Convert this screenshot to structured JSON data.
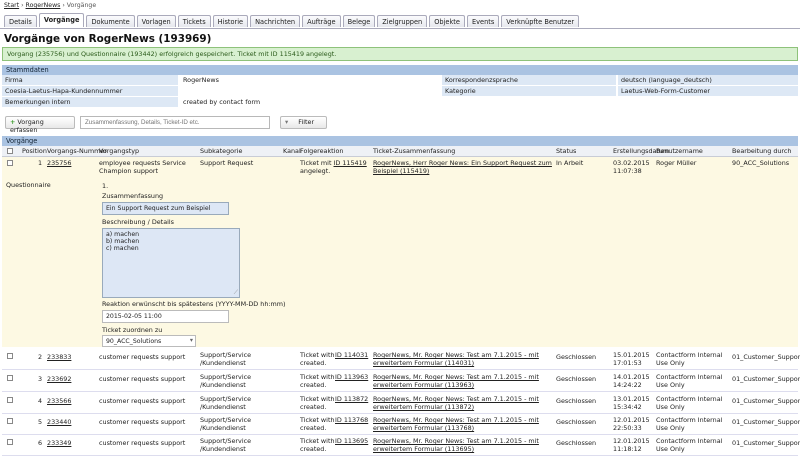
{
  "breadcrumb": {
    "a": "Start",
    "b": "RogerNews",
    "c": "Vorgänge"
  },
  "tabs": [
    "Details",
    "Vorgänge",
    "Dokumente",
    "Vorlagen",
    "Tickets",
    "Historie",
    "Nachrichten",
    "Aufträge",
    "Belege",
    "Zielgruppen",
    "Objekte",
    "Events",
    "Verknüpfte Benutzer"
  ],
  "page_title": "Vorgänge von RogerNews (193969)",
  "success_message": "Vorgang (235756) und Questionnaire (193442) erfolgreich gespeichert. Ticket mit ID 115419 angelegt.",
  "stammdaten": {
    "title": "Stammdaten",
    "firma_label": "Firma",
    "firma_value": "RogerNews",
    "korrespondenz_label": "Korrespondenzsprache",
    "korrespondenz_value": "deutsch (language_deutsch)",
    "kundennummer_label": "Coesia-Laetus-Hapa-Kundennummer",
    "kategorie_label": "Kategorie",
    "kategorie_value": "Laetus-Web-Form-Customer",
    "bemerkungen_label": "Bemerkungen intern",
    "bemerkungen_value": "created by contact form"
  },
  "toolbar": {
    "create_button": "Vorgang erfassen",
    "search_placeholder": "Zusammenfassung, Details, Ticket-ID etc.",
    "filter_button": "Filter"
  },
  "vorgaenge_title": "Vorgänge",
  "columns": {
    "position": "Position",
    "nummer": "Vorgangs-Nummer",
    "typ": "Vorgangstyp",
    "subkategorie": "Subkategorie",
    "kanal": "Kanal",
    "folge": "Folgereaktion",
    "ticket": "Ticket-Zusammenfassung",
    "status": "Status",
    "datum": "Erstellungsdatum",
    "benutzer": "Benutzername",
    "bearbeitung": "Bearbeitung durch"
  },
  "row1": {
    "pos": "1",
    "nummer": "235756",
    "typ1": "employee requests Service",
    "typ2": "Champion support",
    "sub": "Support Request",
    "folge_a": "Ticket mit",
    "folge_id": "ID 115419",
    "folge_b": "angelegt.",
    "ticket1": "RogerNews, Herr Roger News: Ein Support Request zum",
    "ticket2": "Beispiel (115419)",
    "status": "In Arbeit",
    "datum1": "03.02.2015",
    "datum2": "11:07:38",
    "benutzer": "Roger Müller",
    "bearbeitung": "90_ACC_Solutions"
  },
  "questionnaire": {
    "label": "Questionnaire",
    "num": "1.",
    "zusammenfassung_label": "Zusammenfassung",
    "zusammenfassung_value": "Ein Support Request zum Beispiel",
    "beschreibung_label": "Beschreibung / Details",
    "line1": "a) machen",
    "line2": "b) machen",
    "line3": "c) machen",
    "reaktion_label": "Reaktion erwünscht bis spätestens (YYYY-MM-DD hh:mm)",
    "reaktion_value": "2015-02-05 11:00",
    "ticket_label": "Ticket zuordnen zu",
    "ticket_value": "90_ACC_Solutions"
  },
  "rows": [
    {
      "pos": "2",
      "nummer": "233833",
      "typ": "customer requests support",
      "sub1": "Support/Service",
      "sub2": "/Kundendienst",
      "fa": "Ticket with",
      "fid": "ID 114031",
      "fb": "created.",
      "t1": "RogerNews, Mr. Roger News: Test am 7.1.2015 - mit",
      "t2": "erweitertem Formular (114031)",
      "status": "Geschlossen",
      "d1": "15.01.2015",
      "d2": "17:01:53",
      "u1": "Contactform Internal",
      "u2": "Use Only",
      "b": "01_Customer_Support"
    },
    {
      "pos": "3",
      "nummer": "233692",
      "typ": "customer requests support",
      "sub1": "Support/Service",
      "sub2": "/Kundendienst",
      "fa": "Ticket with",
      "fid": "ID 113963",
      "fb": "created.",
      "t1": "RogerNews, Mr. Roger News: Test am 7.1.2015 - mit",
      "t2": "erweitertem Formular (113963)",
      "status": "Geschlossen",
      "d1": "14.01.2015",
      "d2": "14:24:22",
      "u1": "Contactform Internal",
      "u2": "Use Only",
      "b": "01_Customer_Support"
    },
    {
      "pos": "4",
      "nummer": "233566",
      "typ": "customer requests support",
      "sub1": "Support/Service",
      "sub2": "/Kundendienst",
      "fa": "Ticket with",
      "fid": "ID 113872",
      "fb": "created.",
      "t1": "RogerNews, Mr. Roger News: Test am 7.1.2015 - mit",
      "t2": "erweitertem Formular (113872)",
      "status": "Geschlossen",
      "d1": "13.01.2015",
      "d2": "15:34:42",
      "u1": "Contactform Internal",
      "u2": "Use Only",
      "b": "01_Customer_Support"
    },
    {
      "pos": "5",
      "nummer": "233440",
      "typ": "customer requests support",
      "sub1": "Support/Service",
      "sub2": "/Kundendienst",
      "fa": "Ticket with",
      "fid": "ID 113768",
      "fb": "created.",
      "t1": "RogerNews, Mr. Roger News: Test am 7.1.2015 - mit",
      "t2": "erweitertem Formular (113768)",
      "status": "Geschlossen",
      "d1": "12.01.2015",
      "d2": "22:50:33",
      "u1": "Contactform Internal",
      "u2": "Use Only",
      "b": "01_Customer_Support"
    },
    {
      "pos": "6",
      "nummer": "233349",
      "typ": "customer requests support",
      "sub1": "Support/Service",
      "sub2": "/Kundendienst",
      "fa": "Ticket with",
      "fid": "ID 113695",
      "fb": "created.",
      "t1": "RogerNews, Mr. Roger News: Test am 7.1.2015 - mit",
      "t2": "erweitertem Formular (113695)",
      "status": "Geschlossen",
      "d1": "12.01.2015",
      "d2": "11:18:12",
      "u1": "Contactform Internal",
      "u2": "Use Only",
      "b": "01_Customer_Support"
    }
  ]
}
